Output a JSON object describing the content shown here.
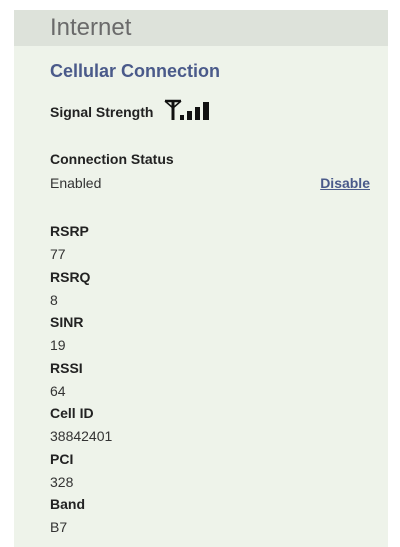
{
  "panel": {
    "title": "Internet"
  },
  "cellular": {
    "section_title": "Cellular Connection",
    "signal_label": "Signal Strength",
    "signal_bars": 4,
    "signal_bars_max": 4
  },
  "connection": {
    "label": "Connection Status",
    "value": "Enabled",
    "action_label": "Disable"
  },
  "metrics": [
    {
      "label": "RSRP",
      "value": "77"
    },
    {
      "label": "RSRQ",
      "value": "8"
    },
    {
      "label": "SINR",
      "value": "19"
    },
    {
      "label": "RSSI",
      "value": "64"
    },
    {
      "label": "Cell ID",
      "value": "38842401"
    },
    {
      "label": "PCI",
      "value": "328"
    },
    {
      "label": "Band",
      "value": "B7"
    }
  ],
  "colors": {
    "panel_bg": "#eef3ea",
    "header_bg": "#dde2da",
    "accent": "#4a5a8a"
  }
}
